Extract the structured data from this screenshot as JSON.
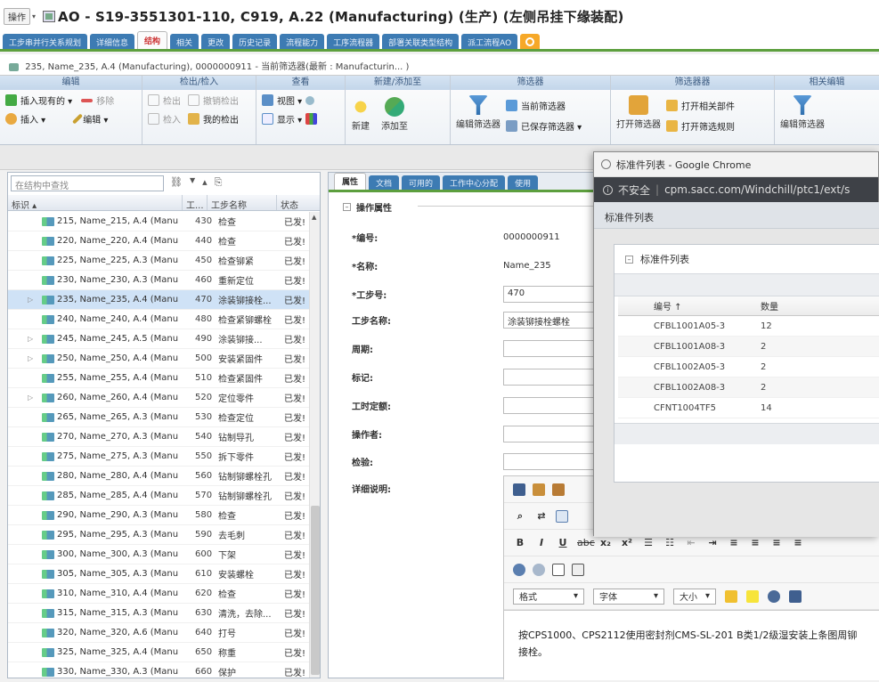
{
  "title": {
    "ops_label": "操作",
    "text": "AO - S19-3551301-110, C919, A.22 (Manufacturing) (生产) (左侧吊挂下缘装配)"
  },
  "tabs": [
    "工步串并行关系规划",
    "详细信息",
    "结构",
    "相关",
    "更改",
    "历史记录",
    "流程能力",
    "工序流程器",
    "部署关联类型结构",
    "派工流程AO"
  ],
  "breadcrumb": "235, Name_235, A.4 (Manufacturing), 0000000911 - 当前筛选器(最新 : Manufacturin... )",
  "ribbon": {
    "groups": [
      {
        "header": "编辑",
        "items": [
          "插入现有的 ▾",
          "移除",
          "插入 ▾",
          "编辑 ▾"
        ]
      },
      {
        "header": "检出/检入",
        "items": [
          "检出",
          "撤销检出",
          "检入",
          "我的检出"
        ]
      },
      {
        "header": "查看",
        "items": [
          "视图 ▾",
          "显示 ▾"
        ]
      },
      {
        "header": "新建/添加至",
        "items": [
          "新建",
          "添加至"
        ]
      },
      {
        "header": "筛选器",
        "items": [
          "当前筛选器",
          "编辑筛选器",
          "已保存筛选器 ▾"
        ]
      },
      {
        "header": "筛选器器",
        "items": [
          "打开相关部件",
          "打开筛选器",
          "打开筛选规则"
        ]
      },
      {
        "header": "相关编辑",
        "items": [
          "编辑筛选器"
        ]
      }
    ]
  },
  "left": {
    "search_placeholder": "在结构中查找",
    "headers": [
      "标识 ▴",
      "工...",
      "工步名称",
      "状态"
    ],
    "rows": [
      {
        "label": "215, Name_215, A.4 (Manu",
        "step": "430",
        "name": "检查",
        "status": "已发!"
      },
      {
        "label": "220, Name_220, A.4 (Manu",
        "step": "440",
        "name": "检查",
        "status": "已发!"
      },
      {
        "label": "225, Name_225, A.3 (Manu",
        "step": "450",
        "name": "检查铆紧",
        "status": "已发!"
      },
      {
        "label": "230, Name_230, A.3 (Manu",
        "step": "460",
        "name": "重新定位",
        "status": "已发!"
      },
      {
        "label": "235, Name_235, A.4 (Manu",
        "step": "470",
        "name": "涂装铆接栓...",
        "status": "已发!"
      },
      {
        "label": "240, Name_240, A.4 (Manu",
        "step": "480",
        "name": "检查紧铆螺栓",
        "status": "已发!"
      },
      {
        "label": "245, Name_245, A.5 (Manu",
        "step": "490",
        "name": "涂装铆接...",
        "status": "已发!"
      },
      {
        "label": "250, Name_250, A.4 (Manu",
        "step": "500",
        "name": "安装紧固件",
        "status": "已发!"
      },
      {
        "label": "255, Name_255, A.4 (Manu",
        "step": "510",
        "name": "检查紧固件",
        "status": "已发!"
      },
      {
        "label": "260, Name_260, A.4 (Manu",
        "step": "520",
        "name": "定位零件",
        "status": "已发!"
      },
      {
        "label": "265, Name_265, A.3 (Manu",
        "step": "530",
        "name": "检查定位",
        "status": "已发!"
      },
      {
        "label": "270, Name_270, A.3 (Manu",
        "step": "540",
        "name": "钻制导孔",
        "status": "已发!"
      },
      {
        "label": "275, Name_275, A.3 (Manu",
        "step": "550",
        "name": "拆下零件",
        "status": "已发!"
      },
      {
        "label": "280, Name_280, A.4 (Manu",
        "step": "560",
        "name": "钻制铆螺栓孔",
        "status": "已发!"
      },
      {
        "label": "285, Name_285, A.4 (Manu",
        "step": "570",
        "name": "钻制铆螺栓孔",
        "status": "已发!"
      },
      {
        "label": "290, Name_290, A.3 (Manu",
        "step": "580",
        "name": "检查",
        "status": "已发!"
      },
      {
        "label": "295, Name_295, A.3 (Manu",
        "step": "590",
        "name": "去毛刺",
        "status": "已发!"
      },
      {
        "label": "300, Name_300, A.3 (Manu",
        "step": "600",
        "name": "下架",
        "status": "已发!"
      },
      {
        "label": "305, Name_305, A.3 (Manu",
        "step": "610",
        "name": "安装螺栓",
        "status": "已发!"
      },
      {
        "label": "310, Name_310, A.4 (Manu",
        "step": "620",
        "name": "检查",
        "status": "已发!"
      },
      {
        "label": "315, Name_315, A.3 (Manu",
        "step": "630",
        "name": "清洗，去除...",
        "status": "已发!"
      },
      {
        "label": "320, Name_320, A.6 (Manu",
        "step": "640",
        "name": "打号",
        "status": "已发!"
      },
      {
        "label": "325, Name_325, A.4 (Manu",
        "step": "650",
        "name": "称重",
        "status": "已发!"
      },
      {
        "label": "330, Name_330, A.3 (Manu",
        "step": "660",
        "name": "保护",
        "status": "已发!"
      }
    ]
  },
  "right": {
    "tabs": [
      "属性",
      "文档",
      "可用的",
      "工作中心分配",
      "使用"
    ],
    "section": "操作属性",
    "fields": {
      "number": {
        "label": "*编号:",
        "value": "0000000911"
      },
      "name": {
        "label": "*名称:",
        "value": "Name_235"
      },
      "step_no": {
        "label": "*工步号:",
        "value": "470"
      },
      "step_name": {
        "label": "工步名称:",
        "value": "涂装铆接栓螺栓"
      },
      "cycle": {
        "label": "周期:",
        "value": ""
      },
      "mark": {
        "label": "标记:",
        "value": ""
      },
      "hours": {
        "label": "工时定额:",
        "value": ""
      },
      "operator": {
        "label": "操作者:",
        "value": ""
      },
      "inspector": {
        "label": "检验:",
        "value": ""
      },
      "detail": {
        "label": "详细说明:"
      }
    },
    "editor": {
      "style_select": "格式",
      "font_select": "字体",
      "size_select": "大小",
      "content": "按CPS1000、CPS2112使用密封剂CMS-SL-201 B类1/2级湿安装上条图周铆接栓。"
    }
  },
  "popup": {
    "window_title": "标准件列表 - Google Chrome",
    "insecure": "不安全",
    "url": "cpm.sacc.com/Windchill/ptc1/ext/s",
    "subheader": "标准件列表",
    "section": "标准件列表",
    "headers": [
      "编号 ↑",
      "数量"
    ],
    "rows": [
      [
        "CFBL1001A05-3",
        "12"
      ],
      [
        "CFBL1001A08-3",
        "2"
      ],
      [
        "CFBL1002A05-3",
        "2"
      ],
      [
        "CFBL1002A08-3",
        "2"
      ],
      [
        "CFNT1004TF5",
        "14"
      ]
    ]
  }
}
